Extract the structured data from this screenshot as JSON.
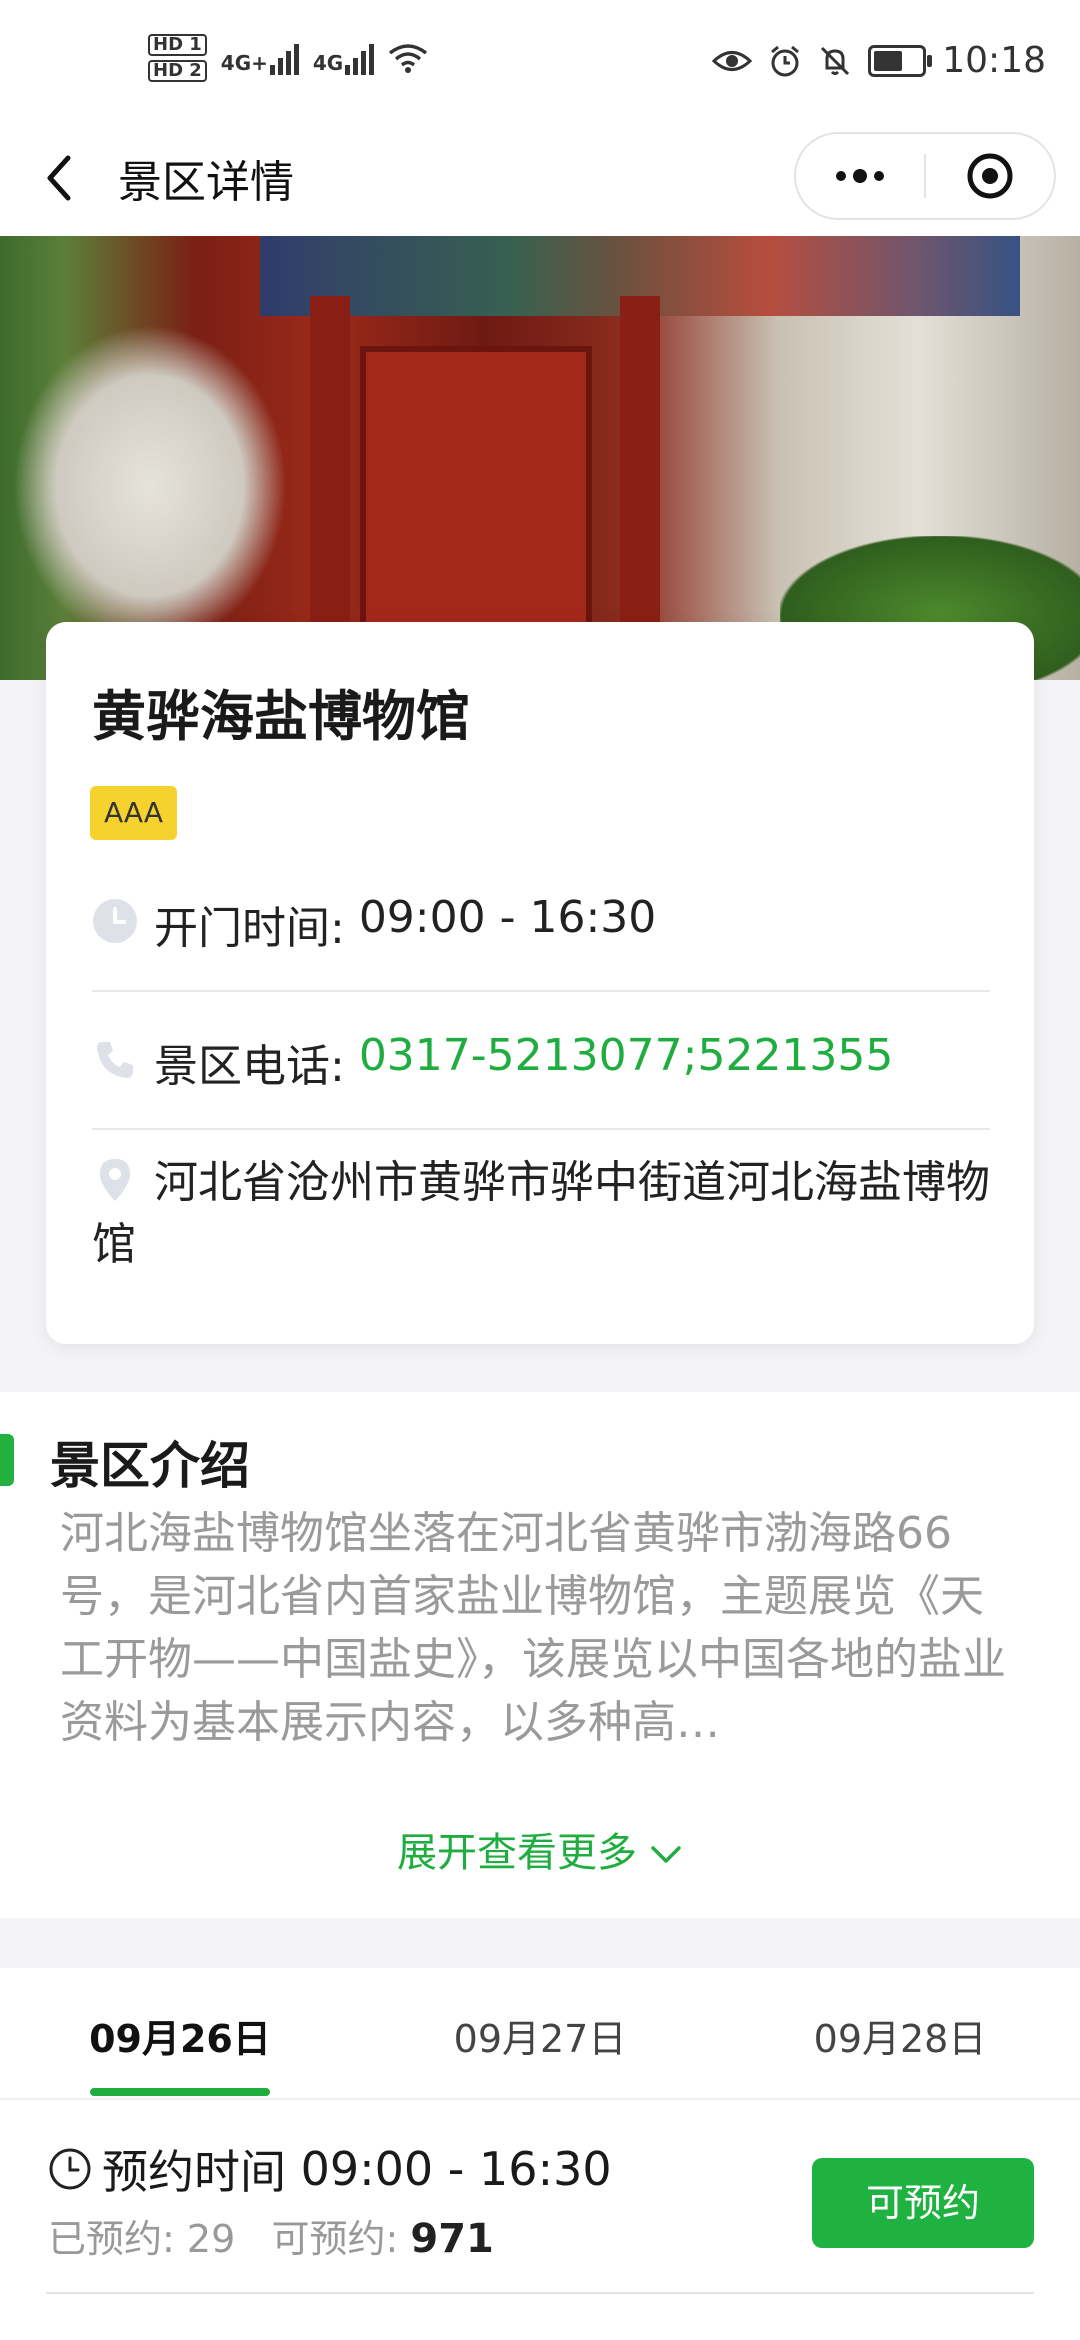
{
  "status_bar": {
    "sim1": "HD 1",
    "sim2": "HD 2",
    "net1": "4G+",
    "net2": "4G",
    "time": "10:18"
  },
  "nav": {
    "title": "景区详情"
  },
  "spot": {
    "name": "黄骅海盐博物馆",
    "level": "AAA",
    "hours_label": "开门时间: ",
    "hours": "09:00 - 16:30",
    "phone_label": "景区电话: ",
    "phone": "0317-5213077;5221355",
    "address": "河北省沧州市黄骅市骅中街道河北海盐博物馆"
  },
  "intro": {
    "title": "景区介绍",
    "text": "河北海盐博物馆坐落在河北省黄骅市渤海路66号，是河北省内首家盐业博物馆，主题展览《天工开物——中国盐史》，该展览以中国各地的盐业资料为基本展示内容，以多种高…",
    "expand_label": "展开查看更多"
  },
  "booking": {
    "dates": [
      "09月26日",
      "09月27日",
      "09月28日"
    ],
    "active_date_index": 0,
    "slot_label": "预约时间 ",
    "slot_time": "09:00 - 16:30",
    "booked_label": "已预约: ",
    "booked": "29",
    "available_label": "可预约: ",
    "available": "971",
    "book_button": "可预约"
  },
  "colors": {
    "accent_green": "#20ad3f",
    "badge_yellow": "#f6d22e"
  }
}
